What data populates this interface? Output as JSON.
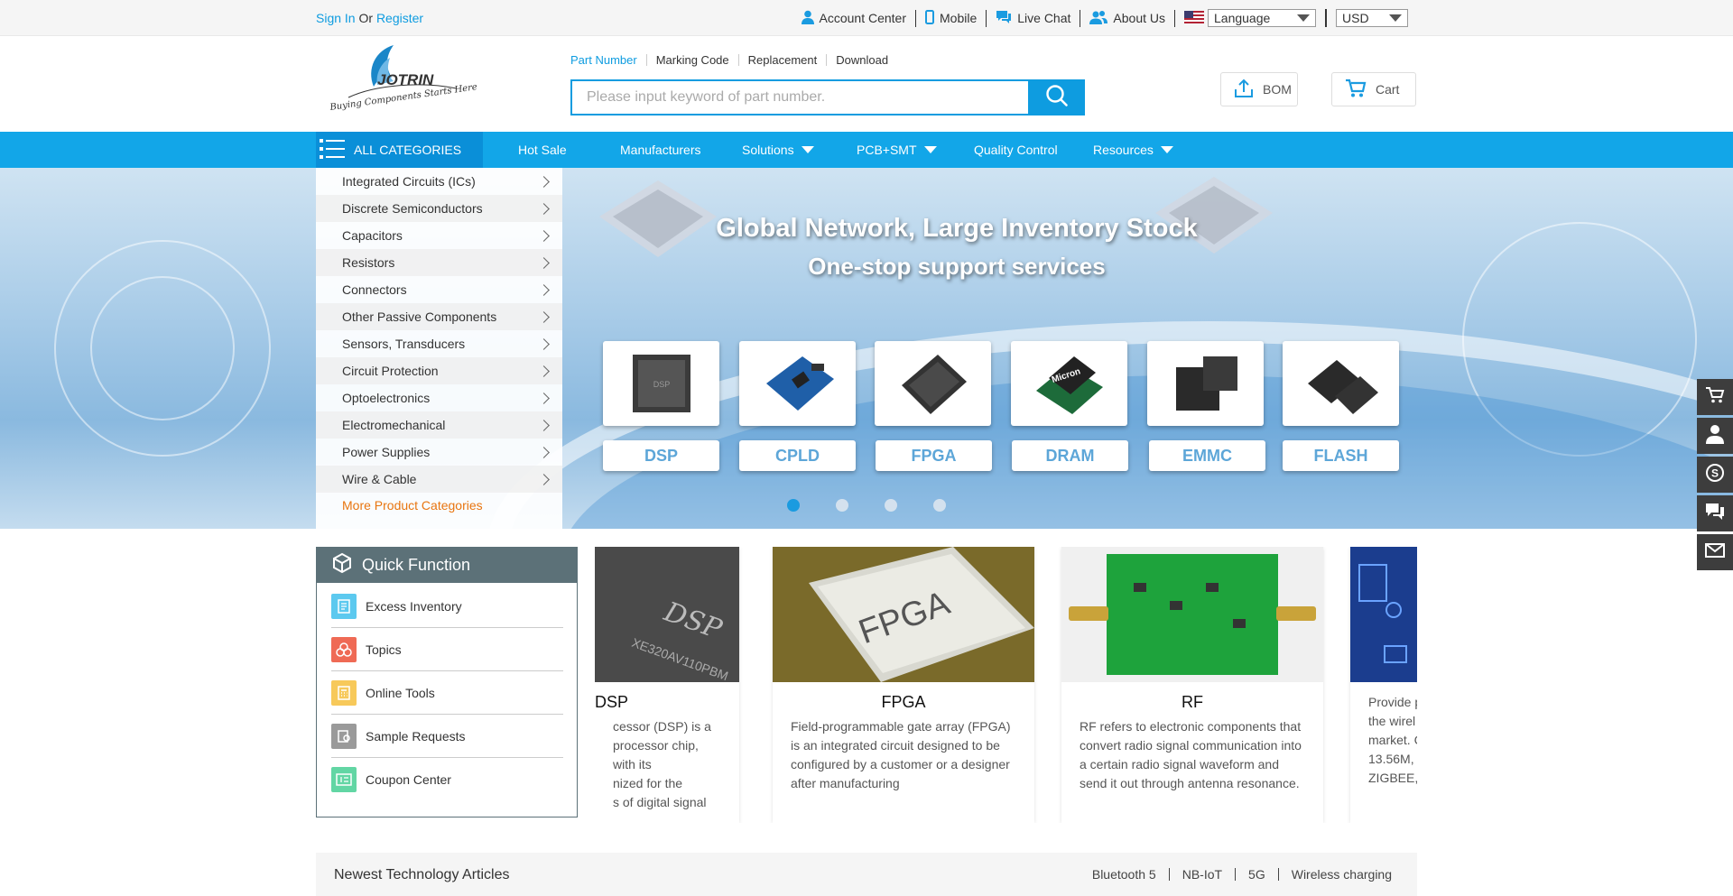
{
  "topbar": {
    "sign_in": "Sign In",
    "or": " Or ",
    "register": "Register",
    "account_center": "Account Center",
    "mobile": "Mobile",
    "live_chat": "Live Chat",
    "about_us": "About Us",
    "language": "Language",
    "currency": "USD"
  },
  "header": {
    "search_tabs": [
      "Part Number",
      "Marking Code",
      "Replacement",
      "Download"
    ],
    "search_placeholder": "Please input keyword of part number.",
    "bom": "BOM",
    "cart": "Cart"
  },
  "nav": {
    "all_categories": "ALL CATEGORIES",
    "items": [
      "Hot Sale",
      "Manufacturers",
      "Solutions",
      "PCB+SMT",
      "Quality Control",
      "Resources"
    ]
  },
  "categories": {
    "items": [
      "Integrated Circuits (ICs)",
      "Discrete Semiconductors",
      "Capacitors",
      "Resistors",
      "Connectors",
      "Other Passive Components",
      "Sensors, Transducers",
      "Circuit Protection",
      "Optoelectronics",
      "Electromechanical",
      "Power Supplies",
      "Wire & Cable"
    ],
    "more": "More Product Categories"
  },
  "banner": {
    "title": "Global Network, Large Inventory Stock",
    "subtitle": "One-stop support services",
    "chips": [
      "DSP",
      "CPLD",
      "FPGA",
      "DRAM",
      "EMMC",
      "FLASH"
    ],
    "slide_count": 4,
    "active_slide": 1
  },
  "quick_function": {
    "title": "Quick Function",
    "items": [
      "Excess Inventory",
      "Topics",
      "Online Tools",
      "Sample Requests",
      "Coupon Center"
    ]
  },
  "cards": [
    {
      "title": "DSP",
      "lines": [
        "cessor (DSP) is a",
        "processor chip, with its",
        "nized for the",
        "s of digital signal"
      ]
    },
    {
      "title": "FPGA",
      "lines": [
        "Field-programmable gate array (FPGA)",
        "is an integrated circuit designed to be",
        "configured by a customer or a designer",
        "after manufacturing"
      ]
    },
    {
      "title": "RF",
      "lines": [
        "RF refers to electronic components that",
        "convert radio signal communication into",
        "a certain radio signal waveform and",
        "send it out through antenna resonance."
      ]
    },
    {
      "title": "",
      "lines": [
        "Provide p",
        "the wirel",
        "market. C",
        "13.56M,",
        "ZIGBEE,"
      ]
    }
  ],
  "articles": {
    "title": "Newest Technology Articles",
    "tags": [
      "Bluetooth 5",
      "NB-IoT",
      "5G",
      "Wireless charging"
    ]
  },
  "colors": {
    "brand_blue": "#0e9ce0",
    "nav_blue": "#12a6e8",
    "more_orange": "#e8750f",
    "quick_header": "#5c7178"
  }
}
